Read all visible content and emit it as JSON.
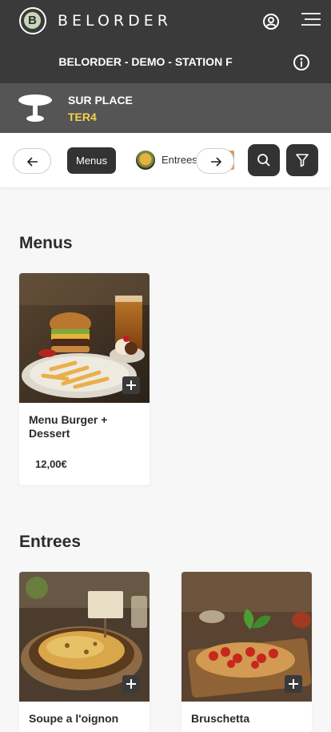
{
  "header": {
    "logo_letter": "B",
    "brand": "BELORDER"
  },
  "station": {
    "title": "BELORDER - DEMO - STATION F"
  },
  "mode": {
    "label": "SUR PLACE",
    "table": "TER4"
  },
  "categories": [
    {
      "label": "Menus",
      "active": true
    },
    {
      "label": "Entrees",
      "active": false
    }
  ],
  "sections": [
    {
      "title": "Menus",
      "products": [
        {
          "name": "Menu Burger + Dessert",
          "price": "12,00€"
        }
      ]
    },
    {
      "title": "Entrees",
      "products": [
        {
          "name": "Soupe a l'oignon",
          "price": ""
        },
        {
          "name": "Bruschetta",
          "price": ""
        }
      ]
    }
  ],
  "colors": {
    "header_bg": "#3a3a3a",
    "mode_bg": "#555555",
    "table_accent": "#f1d44b"
  }
}
